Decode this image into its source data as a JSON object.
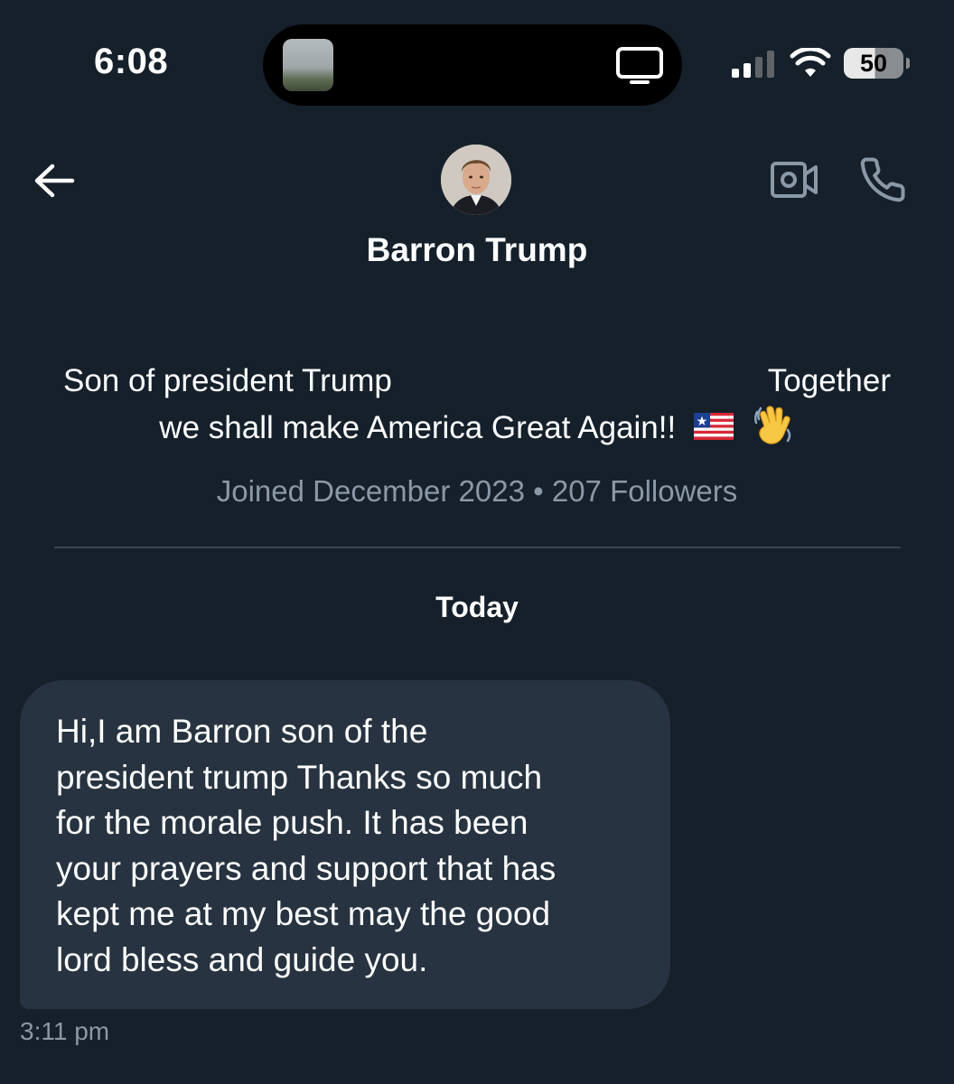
{
  "status_bar": {
    "time": "6:08",
    "battery": "50"
  },
  "icons": {
    "back": "arrow-left-icon",
    "video": "video-camera-icon",
    "phone": "phone-icon",
    "tv": "tv-icon",
    "signal": "cellular-signal-icon",
    "wifi": "wifi-icon",
    "battery": "battery-icon"
  },
  "conversation": {
    "name": "Barron Trump",
    "bio_part1": "Son of president Trump",
    "bio_part2": "Together",
    "bio_part3": "we shall make America Great Again!!",
    "joined": "Joined December 2023",
    "separator": "•",
    "followers": "207 Followers"
  },
  "messages": {
    "date_label": "Today",
    "items": [
      {
        "text": "Hi,I am Barron son of the\npresident trump Thanks so much\nfor the morale push. It has been\nyour prayers and support that has\nkept me at my best may the good\nlord  bless and guide you.",
        "time": "3:11 pm"
      }
    ]
  },
  "colors": {
    "background": "#15202b",
    "bubble": "#273340",
    "secondary_text": "#8b98a5",
    "divider": "#38444d"
  }
}
